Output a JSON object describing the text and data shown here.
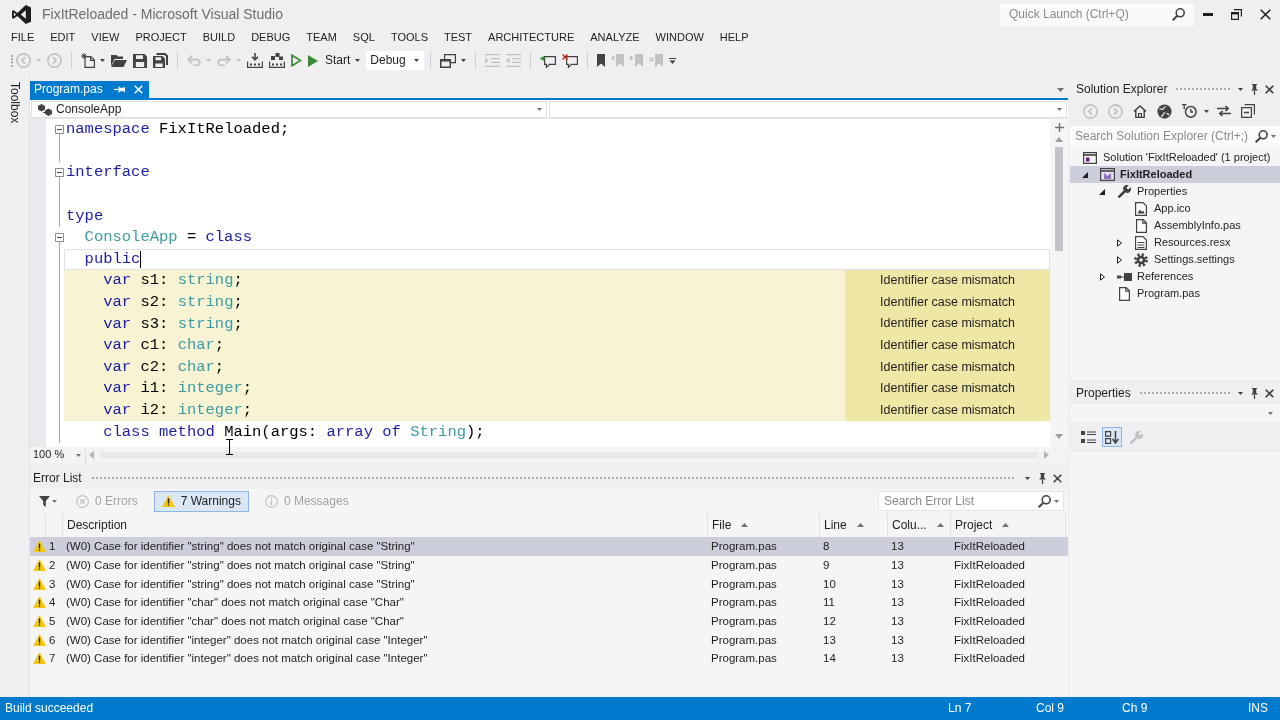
{
  "window": {
    "title": "FixItReloaded - Microsoft Visual Studio"
  },
  "quick_launch": {
    "placeholder": "Quick Launch (Ctrl+Q)"
  },
  "menu": [
    "FILE",
    "EDIT",
    "VIEW",
    "PROJECT",
    "BUILD",
    "DEBUG",
    "TEAM",
    "SQL",
    "TOOLS",
    "TEST",
    "ARCHITECTURE",
    "ANALYZE",
    "WINDOW",
    "HELP"
  ],
  "toolbar": [
    {
      "kind": "back",
      "disabled": true
    },
    {
      "kind": "dropdown",
      "disabled": true
    },
    {
      "kind": "forward",
      "disabled": true
    },
    {
      "kind": "separator"
    },
    {
      "kind": "new-project",
      "disabled": false
    },
    {
      "kind": "dropdown",
      "disabled": false
    },
    {
      "kind": "open",
      "disabled": false
    },
    {
      "kind": "save",
      "disabled": false
    },
    {
      "kind": "save-all",
      "disabled": false
    },
    {
      "kind": "separator"
    },
    {
      "kind": "undo",
      "disabled": true
    },
    {
      "kind": "dropdown",
      "disabled": true
    },
    {
      "kind": "redo",
      "disabled": true
    },
    {
      "kind": "dropdown",
      "disabled": true
    },
    {
      "kind": "build",
      "disabled": false
    },
    {
      "kind": "rebuild",
      "disabled": false
    },
    {
      "kind": "run",
      "disabled": false
    },
    {
      "kind": "start",
      "label": "Start",
      "disabled": false
    },
    {
      "kind": "dropdown",
      "disabled": false
    },
    {
      "kind": "combo",
      "value": "Debug",
      "disabled": false
    },
    {
      "kind": "separator"
    },
    {
      "kind": "windows",
      "disabled": false
    },
    {
      "kind": "dropdown",
      "disabled": false
    },
    {
      "kind": "separator"
    },
    {
      "kind": "indent",
      "disabled": true
    },
    {
      "kind": "outdent",
      "disabled": true
    },
    {
      "kind": "separator"
    },
    {
      "kind": "comment",
      "disabled": false
    },
    {
      "kind": "uncomment",
      "disabled": false
    },
    {
      "kind": "separator"
    },
    {
      "kind": "bookmark",
      "disabled": false
    },
    {
      "kind": "bookmark-previous",
      "disabled": true
    },
    {
      "kind": "bookmark-next",
      "disabled": true
    },
    {
      "kind": "bookmark-clear",
      "disabled": true
    },
    {
      "kind": "overflow",
      "disabled": false
    }
  ],
  "toolbox": {
    "label": "Toolbox"
  },
  "documents": [
    {
      "label": "Program.pas",
      "selected": true
    }
  ],
  "navigation": {
    "type_scope": "ConsoleApp"
  },
  "code": {
    "lines": [
      {
        "kind": "code",
        "foldable": true,
        "current": false,
        "tokens": [
          {
            "kind": "keyword",
            "text": "namespace"
          },
          {
            "kind": "plain",
            "text": " FixItReloaded;"
          }
        ]
      },
      {
        "kind": "blank",
        "foldable": false,
        "current": false
      },
      {
        "kind": "code",
        "foldable": true,
        "current": false,
        "tokens": [
          {
            "kind": "keyword",
            "text": "interface"
          }
        ]
      },
      {
        "kind": "blank",
        "foldable": false,
        "current": false
      },
      {
        "kind": "code",
        "foldable": false,
        "current": false,
        "tokens": [
          {
            "kind": "keyword",
            "text": "type"
          }
        ],
        "children": [
          {
            "kind": "code",
            "foldable": true,
            "current": false,
            "tokens": [
              {
                "kind": "type",
                "text": "ConsoleApp"
              },
              {
                "kind": "plain",
                "text": " = "
              },
              {
                "kind": "keyword",
                "text": "class"
              }
            ]
          },
          {
            "kind": "code",
            "foldable": false,
            "current": true,
            "tokens": [
              {
                "kind": "keyword",
                "text": "public"
              }
            ],
            "children": [
              {
                "kind": "code",
                "foldable": false,
                "current": false,
                "tokens": [
                  {
                    "kind": "keyword",
                    "text": "var"
                  },
                  {
                    "kind": "plain",
                    "text": " s1: "
                  },
                  {
                    "kind": "type",
                    "text": "string"
                  },
                  {
                    "kind": "plain",
                    "text": ";"
                  }
                ],
                "warning": "Identifier case mismatch"
              },
              {
                "kind": "code",
                "foldable": false,
                "current": false,
                "tokens": [
                  {
                    "kind": "keyword",
                    "text": "var"
                  },
                  {
                    "kind": "plain",
                    "text": " s2: "
                  },
                  {
                    "kind": "type",
                    "text": "string"
                  },
                  {
                    "kind": "plain",
                    "text": ";"
                  }
                ],
                "warning": "Identifier case mismatch"
              },
              {
                "kind": "code",
                "foldable": false,
                "current": false,
                "tokens": [
                  {
                    "kind": "keyword",
                    "text": "var"
                  },
                  {
                    "kind": "plain",
                    "text": " s3: "
                  },
                  {
                    "kind": "type",
                    "text": "string"
                  },
                  {
                    "kind": "plain",
                    "text": ";"
                  }
                ],
                "warning": "Identifier case mismatch"
              },
              {
                "kind": "code",
                "foldable": false,
                "current": false,
                "tokens": [
                  {
                    "kind": "keyword",
                    "text": "var"
                  },
                  {
                    "kind": "plain",
                    "text": " c1: "
                  },
                  {
                    "kind": "type",
                    "text": "char"
                  },
                  {
                    "kind": "plain",
                    "text": ";"
                  }
                ],
                "warning": "Identifier case mismatch"
              },
              {
                "kind": "code",
                "foldable": false,
                "current": false,
                "tokens": [
                  {
                    "kind": "keyword",
                    "text": "var"
                  },
                  {
                    "kind": "plain",
                    "text": " c2: "
                  },
                  {
                    "kind": "type",
                    "text": "char"
                  },
                  {
                    "kind": "plain",
                    "text": ";"
                  }
                ],
                "warning": "Identifier case mismatch"
              },
              {
                "kind": "code",
                "foldable": false,
                "current": false,
                "tokens": [
                  {
                    "kind": "keyword",
                    "text": "var"
                  },
                  {
                    "kind": "plain",
                    "text": " i1: "
                  },
                  {
                    "kind": "type",
                    "text": "integer"
                  },
                  {
                    "kind": "plain",
                    "text": ";"
                  }
                ],
                "warning": "Identifier case mismatch"
              },
              {
                "kind": "code",
                "foldable": false,
                "current": false,
                "tokens": [
                  {
                    "kind": "keyword",
                    "text": "var"
                  },
                  {
                    "kind": "plain",
                    "text": " i2: "
                  },
                  {
                    "kind": "type",
                    "text": "integer"
                  },
                  {
                    "kind": "plain",
                    "text": ";"
                  }
                ],
                "warning": "Identifier case mismatch"
              },
              {
                "kind": "code",
                "foldable": false,
                "current": false,
                "tokens": [
                  {
                    "kind": "keyword",
                    "text": "class method"
                  },
                  {
                    "kind": "plain",
                    "text": " Main(args: "
                  },
                  {
                    "kind": "keyword",
                    "text": "array of "
                  },
                  {
                    "kind": "type",
                    "text": "String"
                  },
                  {
                    "kind": "plain",
                    "text": ");"
                  }
                ]
              }
            ]
          }
        ]
      }
    ]
  },
  "editor_zoom": "100 %",
  "error_list": {
    "title": "Error List",
    "filters": [
      {
        "kind": "error",
        "label": "0 Errors",
        "selected": false,
        "disabled": true
      },
      {
        "kind": "warning",
        "label": "7 Warnings",
        "selected": true,
        "disabled": false
      },
      {
        "kind": "message",
        "label": "0 Messages",
        "selected": false,
        "disabled": true
      }
    ],
    "search": {
      "placeholder": "Search Error List"
    },
    "columns": [
      {
        "label": "Description",
        "sorted": false
      },
      {
        "label": "File",
        "sorted": true
      },
      {
        "label": "Line",
        "sorted": true
      },
      {
        "label": "Colu...",
        "sorted": true
      },
      {
        "label": "Project",
        "sorted": true
      }
    ],
    "rows": [
      {
        "kind": "warning",
        "number": "1",
        "description": "(W0) Case for identifier \"string\" does not match original case \"String\"",
        "file": "Program.pas",
        "line": "8",
        "column": "13",
        "project": "FixItReloaded",
        "selected": true
      },
      {
        "kind": "warning",
        "number": "2",
        "description": "(W0) Case for identifier \"string\" does not match original case \"String\"",
        "file": "Program.pas",
        "line": "9",
        "column": "13",
        "project": "FixItReloaded",
        "selected": false
      },
      {
        "kind": "warning",
        "number": "3",
        "description": "(W0) Case for identifier \"string\" does not match original case \"String\"",
        "file": "Program.pas",
        "line": "10",
        "column": "13",
        "project": "FixItReloaded",
        "selected": false
      },
      {
        "kind": "warning",
        "number": "4",
        "description": "(W0) Case for identifier \"char\" does not match original case \"Char\"",
        "file": "Program.pas",
        "line": "11",
        "column": "13",
        "project": "FixItReloaded",
        "selected": false
      },
      {
        "kind": "warning",
        "number": "5",
        "description": "(W0) Case for identifier \"char\" does not match original case \"Char\"",
        "file": "Program.pas",
        "line": "12",
        "column": "13",
        "project": "FixItReloaded",
        "selected": false
      },
      {
        "kind": "warning",
        "number": "6",
        "description": "(W0) Case for identifier \"integer\" does not match original case \"Integer\"",
        "file": "Program.pas",
        "line": "13",
        "column": "13",
        "project": "FixItReloaded",
        "selected": false
      },
      {
        "kind": "warning",
        "number": "7",
        "description": "(W0) Case for identifier \"integer\" does not match original case \"Integer\"",
        "file": "Program.pas",
        "line": "14",
        "column": "13",
        "project": "FixItReloaded",
        "selected": false
      }
    ]
  },
  "solution_explorer": {
    "title": "Solution Explorer",
    "toolbar": [
      {
        "kind": "back",
        "disabled": true
      },
      {
        "kind": "forward",
        "disabled": true
      },
      {
        "kind": "home",
        "disabled": false
      },
      {
        "kind": "show-files",
        "disabled": false
      },
      {
        "kind": "clock",
        "disabled": false
      },
      {
        "kind": "dropdown",
        "disabled": false
      },
      {
        "kind": "sync",
        "disabled": false
      },
      {
        "kind": "collapse",
        "disabled": false
      }
    ],
    "search": {
      "placeholder": "Search Solution Explorer (Ctrl+;)"
    },
    "tree": [
      {
        "label": "Solution 'FixItReloaded' (1 project)",
        "kind": "solution",
        "selected": false,
        "startup": false,
        "children": [
          {
            "label": "FixItReloaded",
            "kind": "project",
            "expandable": true,
            "expanded": true,
            "selected": true,
            "startup": true,
            "children": [
              {
                "label": "Properties",
                "kind": "properties",
                "expandable": true,
                "expanded": true,
                "selected": false,
                "startup": false,
                "children": [
                  {
                    "label": "App.ico",
                    "kind": "image-file",
                    "expandable": false,
                    "selected": false,
                    "startup": false
                  },
                  {
                    "label": "AssemblyInfo.pas",
                    "kind": "file",
                    "expandable": false,
                    "selected": false,
                    "startup": false
                  },
                  {
                    "label": "Resources.resx",
                    "kind": "resource-file",
                    "expandable": true,
                    "expanded": false,
                    "selected": false,
                    "startup": false
                  },
                  {
                    "label": "Settings.settings",
                    "kind": "settings",
                    "expandable": true,
                    "expanded": false,
                    "selected": false,
                    "startup": false
                  }
                ]
              },
              {
                "label": "References",
                "kind": "references",
                "expandable": true,
                "expanded": false,
                "selected": false,
                "startup": false
              },
              {
                "label": "Program.pas",
                "kind": "file",
                "expandable": false,
                "selected": false,
                "startup": false
              }
            ]
          }
        ]
      }
    ]
  },
  "properties": {
    "title": "Properties",
    "toolbar": [
      {
        "kind": "categorized",
        "selected": false,
        "disabled": false
      },
      {
        "kind": "alphabetical",
        "selected": true,
        "disabled": false
      },
      {
        "kind": "property-pages",
        "selected": false,
        "disabled": true
      }
    ]
  },
  "status_bar": {
    "message": "Build succeeded",
    "line": "Ln 7",
    "column": "Col 9",
    "char": "Ch 9",
    "mode": "INS"
  }
}
